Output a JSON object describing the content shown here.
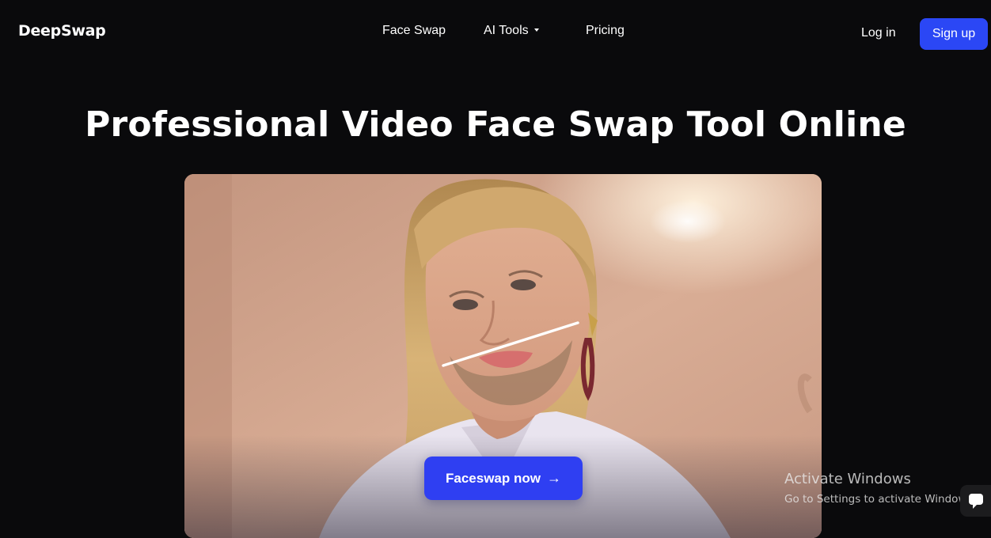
{
  "brand": {
    "name": "DeepSwap"
  },
  "nav": {
    "links": [
      {
        "label": "Face Swap"
      },
      {
        "label": "AI Tools",
        "has_dropdown": true
      },
      {
        "label": "Pricing"
      }
    ],
    "login_label": "Log in",
    "signup_label": "Sign up"
  },
  "hero": {
    "title": "Professional Video Face Swap Tool Online",
    "cta_label": "Faceswap now",
    "cta_icon": "arrow-right-icon"
  },
  "os_watermark": {
    "title": "Activate Windows",
    "subtitle": "Go to Settings to activate Windows."
  },
  "chat": {
    "icon": "chat-bubble-icon"
  },
  "colors": {
    "background": "#0a0a0c",
    "accent": "#2b47f5",
    "cta": "#2f3ff2",
    "text": "#ffffff"
  }
}
